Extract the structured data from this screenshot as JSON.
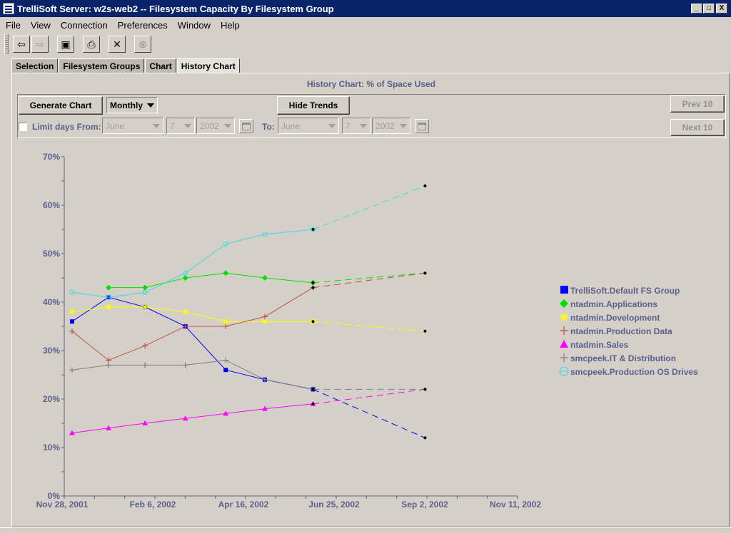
{
  "window": {
    "title": "TrelliSoft Server:  w2s-web2 -- Filesystem Capacity By Filesystem Group",
    "controls": [
      "_",
      "□",
      "X"
    ]
  },
  "menubar": {
    "items": [
      "File",
      "View",
      "Connection",
      "Preferences",
      "Window",
      "Help"
    ]
  },
  "toolbar": {
    "buttons": [
      {
        "name": "back-icon",
        "glyph": "⇦"
      },
      {
        "name": "forward-icon",
        "glyph": "⇨"
      },
      {
        "name": "save-icon",
        "glyph": "▣"
      },
      {
        "name": "print-icon",
        "glyph": "⎙"
      },
      {
        "name": "close-icon",
        "glyph": "✕"
      },
      {
        "name": "stop-icon",
        "glyph": "⊗"
      }
    ]
  },
  "tabs": [
    {
      "label": "Selection",
      "active": false
    },
    {
      "label": "Filesystem Groups",
      "active": false
    },
    {
      "label": "Chart",
      "active": false
    },
    {
      "label": "History Chart",
      "active": true
    }
  ],
  "panel": {
    "title": "History Chart: % of Space Used",
    "generate_label": "Generate Chart",
    "interval_value": "Monthly",
    "hide_trends_label": "Hide Trends",
    "prev_label": "Prev 10",
    "next_label": "Next 10",
    "limit_label": "Limit days From:",
    "to_label": "To:",
    "from": {
      "month": "June",
      "day": "7",
      "year": "2002"
    },
    "to": {
      "month": "June",
      "day": "7",
      "year": "2002"
    }
  },
  "chart_data": {
    "type": "line",
    "title": "",
    "xlabel": "",
    "ylabel": "",
    "x_ticks": [
      "Nov 28, 2001",
      "Feb 6, 2002",
      "Apr 16, 2002",
      "Jun 25, 2002",
      "Sep 2, 2002",
      "Nov 11, 2002"
    ],
    "x_range": [
      "2001-11-28",
      "2002-11-11"
    ],
    "y_ticks": [
      "0%",
      "10%",
      "20%",
      "30%",
      "40%",
      "50%",
      "60%",
      "70%"
    ],
    "ylim": [
      0,
      70
    ],
    "trend_style": "dashed",
    "legend_position": "right",
    "series": [
      {
        "name": "TrelliSoft.Default FS Group",
        "color": "#0000ff",
        "marker": "square",
        "points": [
          [
            "2001-12-04",
            36
          ],
          [
            "2002-01-01",
            41
          ],
          [
            "2002-01-29",
            39
          ],
          [
            "2002-03-01",
            35
          ],
          [
            "2002-04-01",
            26
          ],
          [
            "2002-05-01",
            24
          ],
          [
            "2002-06-07",
            22
          ]
        ],
        "trend": [
          [
            "2002-06-07",
            22
          ],
          [
            "2002-09-01",
            12
          ]
        ]
      },
      {
        "name": "ntadmin.Applications",
        "color": "#00e000",
        "marker": "diamond",
        "points": [
          [
            "2002-01-01",
            43
          ],
          [
            "2002-01-29",
            43
          ],
          [
            "2002-03-01",
            45
          ],
          [
            "2002-04-01",
            46
          ],
          [
            "2002-05-01",
            45
          ],
          [
            "2002-06-07",
            44
          ]
        ],
        "trend": [
          [
            "2002-06-07",
            44
          ],
          [
            "2002-09-01",
            46
          ]
        ]
      },
      {
        "name": "ntadmin.Development",
        "color": "#ffff00",
        "marker": "star",
        "points": [
          [
            "2001-12-04",
            38
          ],
          [
            "2002-01-01",
            39
          ],
          [
            "2002-01-29",
            39
          ],
          [
            "2002-03-01",
            38
          ],
          [
            "2002-04-01",
            36
          ],
          [
            "2002-05-01",
            36
          ],
          [
            "2002-06-07",
            36
          ]
        ],
        "trend": [
          [
            "2002-06-07",
            36
          ],
          [
            "2002-09-01",
            34
          ]
        ]
      },
      {
        "name": "ntadmin.Production Data",
        "color": "#c0504d",
        "marker": "plus",
        "points": [
          [
            "2001-12-04",
            34
          ],
          [
            "2002-01-01",
            28
          ],
          [
            "2002-01-29",
            31
          ],
          [
            "2002-03-01",
            35
          ],
          [
            "2002-04-01",
            35
          ],
          [
            "2002-05-01",
            37
          ],
          [
            "2002-06-07",
            43
          ]
        ],
        "trend": [
          [
            "2002-06-07",
            43
          ],
          [
            "2002-09-01",
            46
          ]
        ]
      },
      {
        "name": "ntadmin.Sales",
        "color": "#ff00ff",
        "marker": "triangle",
        "points": [
          [
            "2001-12-04",
            13
          ],
          [
            "2002-01-01",
            14
          ],
          [
            "2002-01-29",
            15
          ],
          [
            "2002-03-01",
            16
          ],
          [
            "2002-04-01",
            17
          ],
          [
            "2002-05-01",
            18
          ],
          [
            "2002-06-07",
            19
          ]
        ],
        "trend": [
          [
            "2002-06-07",
            19
          ],
          [
            "2002-09-01",
            22
          ]
        ]
      },
      {
        "name": "smcpeek.IT & Distribution",
        "color": "#808080",
        "marker": "plus",
        "points": [
          [
            "2001-12-04",
            26
          ],
          [
            "2002-01-01",
            27
          ],
          [
            "2002-01-29",
            27
          ],
          [
            "2002-03-01",
            27
          ],
          [
            "2002-04-01",
            28
          ],
          [
            "2002-05-01",
            24
          ],
          [
            "2002-06-07",
            22
          ]
        ],
        "trend": [
          [
            "2002-06-07",
            22
          ],
          [
            "2002-09-01",
            22
          ]
        ]
      },
      {
        "name": "smcpeek.Production OS Drives",
        "color": "#33dddd",
        "marker": "circle",
        "points": [
          [
            "2001-12-04",
            42
          ],
          [
            "2002-01-01",
            41
          ],
          [
            "2002-01-29",
            42
          ],
          [
            "2002-03-01",
            46
          ],
          [
            "2002-04-01",
            52
          ],
          [
            "2002-05-01",
            54
          ],
          [
            "2002-06-07",
            55
          ]
        ],
        "trend": [
          [
            "2002-06-07",
            55
          ],
          [
            "2002-09-01",
            64
          ]
        ]
      }
    ]
  }
}
